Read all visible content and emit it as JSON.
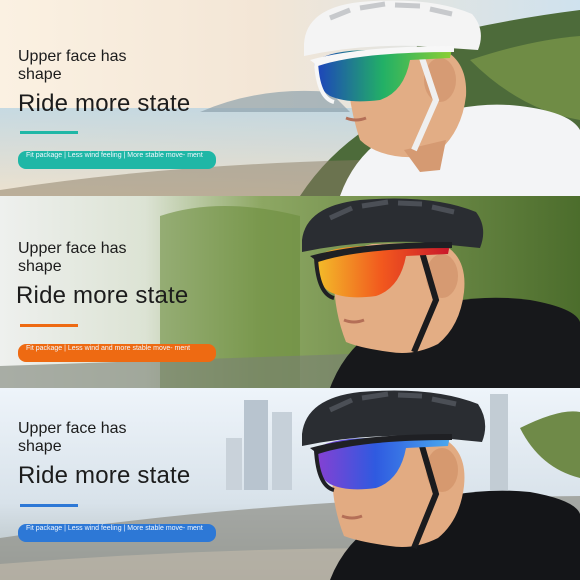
{
  "panels": [
    {
      "subtitle": "Upper face has shape",
      "headline": "Ride more state",
      "pill": "Fit package | Less wind feeling | More stable move- ment",
      "accent": "#1fb7a6",
      "lens_colors": [
        "#1d3fbf",
        "#22b066",
        "#8ccf33"
      ],
      "helmet_color": "#f4f4f4"
    },
    {
      "subtitle": "Upper face has shape",
      "headline": "Ride more state",
      "pill": "Fit package | Less wind and more stable move- ment",
      "accent": "#ee6a12",
      "lens_colors": [
        "#f3c02a",
        "#f2581e",
        "#c9182b"
      ],
      "helmet_color": "#2a2d32"
    },
    {
      "subtitle": "Upper face has shape",
      "headline": "Ride more state",
      "pill": "Fit package | Less wind feeling | More stable move- ment",
      "accent": "#2d78d6",
      "lens_colors": [
        "#2f5ae0",
        "#4aa8ee",
        "#8a3fd2"
      ],
      "helmet_color": "#2a2d32"
    }
  ]
}
